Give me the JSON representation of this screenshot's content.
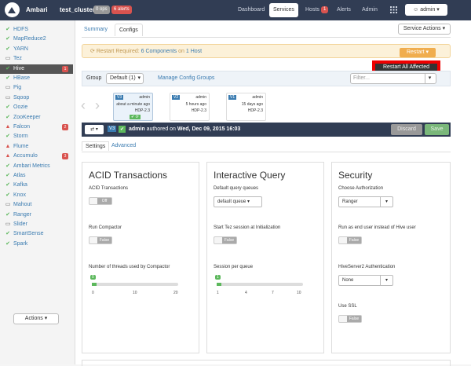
{
  "topbar": {
    "brand": "Ambari",
    "cluster": "test_cluster",
    "ops_badge": "0 ops",
    "alerts_badge": "6 alerts",
    "nav": [
      "Dashboard",
      "Services",
      "Hosts",
      "Alerts",
      "Admin"
    ],
    "hosts_count": "1",
    "admin_label": "admin"
  },
  "sidebar": {
    "services": [
      {
        "name": "HDFS",
        "icon": "check-icon"
      },
      {
        "name": "MapReduce2",
        "icon": "check-icon"
      },
      {
        "name": "YARN",
        "icon": "check-icon"
      },
      {
        "name": "Tez",
        "icon": "laptop-icon"
      },
      {
        "name": "Hive",
        "icon": "check-icon",
        "badge": "1"
      },
      {
        "name": "HBase",
        "icon": "check-icon"
      },
      {
        "name": "Pig",
        "icon": "laptop-icon"
      },
      {
        "name": "Sqoop",
        "icon": "laptop-icon"
      },
      {
        "name": "Oozie",
        "icon": "check-icon"
      },
      {
        "name": "ZooKeeper",
        "icon": "check-icon"
      },
      {
        "name": "Falcon",
        "icon": "warning-icon",
        "badge": "2"
      },
      {
        "name": "Storm",
        "icon": "check-icon"
      },
      {
        "name": "Flume",
        "icon": "warning-icon"
      },
      {
        "name": "Accumulo",
        "icon": "warning-icon",
        "badge": "3"
      },
      {
        "name": "Ambari Metrics",
        "icon": "check-icon"
      },
      {
        "name": "Atlas",
        "icon": "check-icon"
      },
      {
        "name": "Kafka",
        "icon": "check-icon"
      },
      {
        "name": "Knox",
        "icon": "check-icon"
      },
      {
        "name": "Mahout",
        "icon": "laptop-icon"
      },
      {
        "name": "Ranger",
        "icon": "check-icon"
      },
      {
        "name": "Slider",
        "icon": "laptop-icon"
      },
      {
        "name": "SmartSense",
        "icon": "check-icon"
      },
      {
        "name": "Spark",
        "icon": "check-icon"
      }
    ],
    "actions_label": "Actions"
  },
  "main": {
    "tabs": [
      "Summary",
      "Configs"
    ],
    "service_actions": "Service Actions",
    "restart_text": "Restart Required:",
    "restart_link": "6 Components",
    "restart_on": "on",
    "restart_host": "1 Host",
    "restart_button": "Restart",
    "restart_all_affected": "Restart All Affected",
    "group_label": "Group",
    "group_value": "Default (1)",
    "manage_groups": "Manage Config Groups",
    "filter_placeholder": "Filter...",
    "versions": [
      {
        "tag": "V3",
        "user": "admin",
        "time": "about a minute ago",
        "stack": "HDP-2.3"
      },
      {
        "tag": "V2",
        "user": "admin",
        "time": "5 hours ago",
        "stack": "HDP-2.3"
      },
      {
        "tag": "V1",
        "user": "admin",
        "time": "15 days ago",
        "stack": "HDP-2.3"
      }
    ],
    "authored_tag": "V3",
    "authored_user": "admin",
    "authored_text": "authored on",
    "authored_date": "Wed, Dec 09, 2015 16:03",
    "discard": "Discard",
    "save": "Save",
    "settings_tabs": [
      "Settings",
      "Advanced"
    ]
  },
  "panels": {
    "acid": {
      "title": "ACID Transactions",
      "acid_label": "ACID Transactions",
      "acid_value": "Off",
      "compactor_label": "Run Compactor",
      "compactor_value": "False",
      "threads_label": "Number of threads used by Compactor",
      "threads_value": "0",
      "threads_ticks": [
        "0",
        "10",
        "20"
      ]
    },
    "interactive": {
      "title": "Interactive Query",
      "queues_label": "Default query queues",
      "queues_value": "default queue",
      "tez_label": "Start Tez session at Initialization",
      "tez_value": "False",
      "session_label": "Session per queue",
      "session_value": "1",
      "session_ticks": [
        "1",
        "4",
        "7",
        "10"
      ]
    },
    "security": {
      "title": "Security",
      "auth_label": "Choose Authorization",
      "auth_value": "Ranger",
      "enduser_label": "Run as end user instead of Hive user",
      "enduser_value": "False",
      "hs2_label": "HiveServer2 Authentication",
      "hs2_value": "None",
      "ssl_label": "Use SSL",
      "ssl_value": "False"
    }
  }
}
